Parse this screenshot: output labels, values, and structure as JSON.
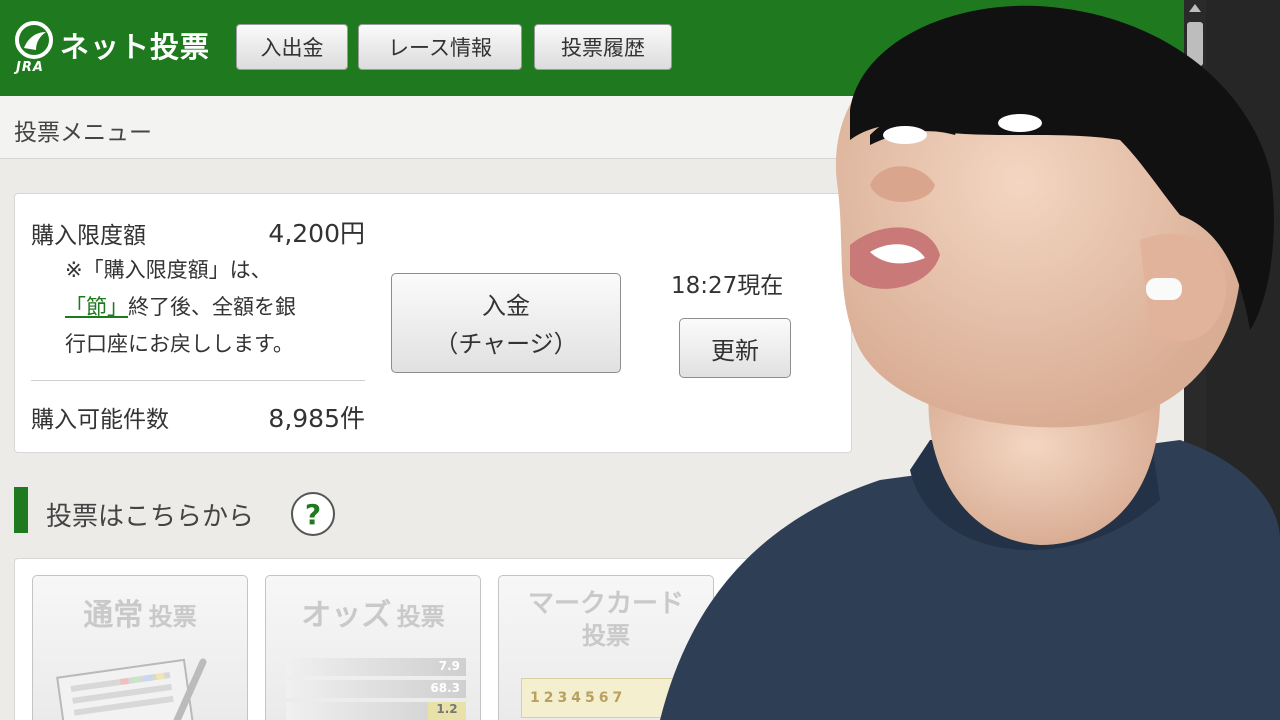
{
  "header": {
    "logo_sub": "JRA",
    "logo_text": "ネット投票",
    "nav": [
      {
        "label": "入出金"
      },
      {
        "label": "レース情報"
      },
      {
        "label": "投票履歴"
      }
    ]
  },
  "subheader": {
    "title": "投票メニュー"
  },
  "account": {
    "limit_label": "購入限度額",
    "limit_value": "4,200円",
    "note_line1": "※「購入限度額」は、",
    "note_link": "「節」",
    "note_line2_rest": "終了後、全額を銀",
    "note_line3": "行口座にお戻しします。",
    "count_label": "購入可能件数",
    "count_value": "8,985件",
    "charge_button_line1": "入金",
    "charge_button_line2": "（チャージ）",
    "timestamp": "18:27現在",
    "refresh_button": "更新"
  },
  "voting": {
    "section_title": "投票はこちらから",
    "help_icon_text": "?",
    "cards": [
      {
        "title_main": "通常",
        "title_sub": "投票"
      },
      {
        "title_main": "オッズ",
        "title_sub": "投票",
        "odds": [
          "7.9",
          "68.3",
          "1.2"
        ]
      },
      {
        "title_main": "マークカード",
        "title_sub": "投票",
        "digits": [
          "1",
          "2",
          "3",
          "4",
          "5",
          "6",
          "7"
        ]
      }
    ]
  },
  "colors": {
    "brand_green": "#1f7a1f",
    "background": "#ecebe8",
    "panel": "#ffffff"
  }
}
